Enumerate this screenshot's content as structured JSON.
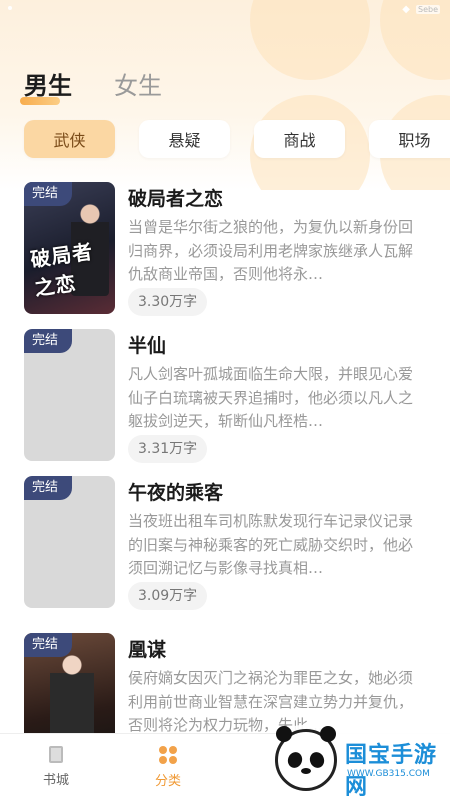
{
  "status_bar": {
    "battery": "Sebe"
  },
  "gender_tabs": [
    {
      "label": "男生",
      "active": true
    },
    {
      "label": "女生",
      "active": false
    }
  ],
  "categories": [
    {
      "label": "武侠",
      "active": true
    },
    {
      "label": "悬疑",
      "active": false
    },
    {
      "label": "商战",
      "active": false
    },
    {
      "label": "职场",
      "active": false
    }
  ],
  "books": [
    {
      "badge": "完结",
      "title": "破局者之恋",
      "cover_title": "破局者之恋",
      "description": "当曾是华尔街之狼的他，为复仇以新身份回归商界，必须设局利用老牌家族继承人瓦解仇敌商业帝国，否则他将永…",
      "word_count": "3.30万字"
    },
    {
      "badge": "完结",
      "title": "半仙",
      "description": "凡人剑客叶孤城面临生命大限，并眼见心爱仙子白琉璃被天界追捕时，他必须以凡人之躯拔剑逆天，斩断仙凡桎梏…",
      "word_count": "3.31万字"
    },
    {
      "badge": "完结",
      "title": "午夜的乘客",
      "description": "当夜班出租车司机陈默发现行车记录仪记录的旧案与神秘乘客的死亡威胁交织时，他必须回溯记忆与影像寻找真相…",
      "word_count": "3.09万字"
    },
    {
      "badge": "完结",
      "title": "凰谋",
      "description": "侯府嫡女因灭门之祸沦为罪臣之女，她必须利用前世商业智慧在深宫建立势力并复仇，否则将沦为权力玩物，失此…",
      "word_count": ""
    }
  ],
  "bottom_nav": [
    {
      "label": "书城",
      "icon": "book-icon",
      "active": false
    },
    {
      "label": "分类",
      "icon": "category-icon",
      "active": true
    }
  ],
  "watermark": {
    "title": "国宝手游网",
    "url": "WWW.GB315.COM"
  },
  "colors": {
    "accent": "#f09a36",
    "active_pill": "#fbd7a3",
    "badge": "#3d4a7a"
  }
}
